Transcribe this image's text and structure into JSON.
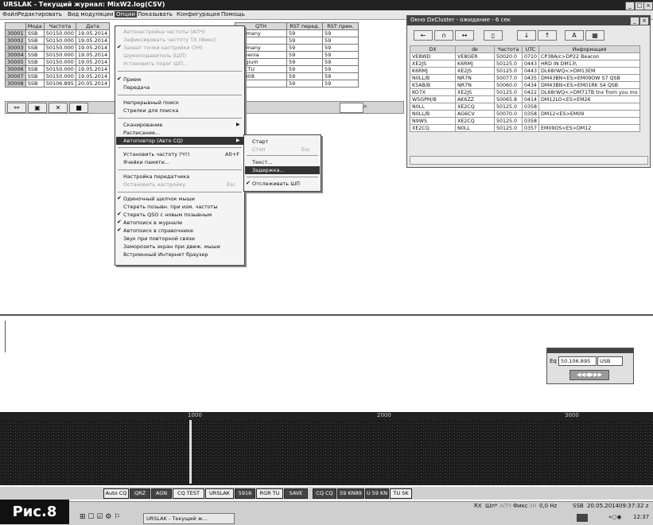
{
  "window_title": "URSLAK - Текущий журнал: MixW2.log(CSV)",
  "menubar": [
    "Файл",
    "Редактировать",
    "Вид модуляции",
    "Опции",
    "Показывать",
    "Конфигурация",
    "Помощь"
  ],
  "log": {
    "headers": [
      "",
      "Мода",
      "Частота",
      "Дата"
    ],
    "rows": [
      {
        "num": "30001",
        "mode": "SSB",
        "freq": "50150.000",
        "date": "19.05.2014"
      },
      {
        "num": "30002",
        "mode": "SSB",
        "freq": "50150.000",
        "date": "19.05.2014"
      },
      {
        "num": "30003",
        "mode": "SSB",
        "freq": "50150.000",
        "date": "19.05.2014"
      },
      {
        "num": "30004",
        "mode": "SSB",
        "freq": "50150.000",
        "date": "19.05.2014"
      },
      {
        "num": "30005",
        "mode": "SSB",
        "freq": "50150.000",
        "date": "19.05.2014"
      },
      {
        "num": "30006",
        "mode": "SSB",
        "freq": "50150.000",
        "date": "19.05.2014"
      },
      {
        "num": "30007",
        "mode": "SSB",
        "freq": "50150.000",
        "date": "19.05.2014"
      },
      {
        "num": "30008",
        "mode": "SSB",
        "freq": "50106.895",
        "date": "20.05.2014"
      }
    ],
    "headers2": [
      "QTH",
      "RST перед.",
      "RST прин."
    ],
    "rows2": [
      [
        "Germany",
        "59",
        "59"
      ],
      [
        "TUE",
        "59",
        "59"
      ],
      [
        "Germany",
        "59",
        "59"
      ],
      [
        "Slovenia",
        "59",
        "59"
      ],
      [
        "Belgium",
        "59",
        "59"
      ],
      [
        "D51TU",
        "59",
        "59"
      ],
      [
        "CD408",
        "59",
        "59"
      ],
      [
        "",
        "59",
        "59"
      ]
    ]
  },
  "options_menu": {
    "items": [
      {
        "label": "Автонастройка частоты (АПЧ)",
        "disabled": true
      },
      {
        "label": "Зафиксировать частоту TX (Фикс)",
        "disabled": true
      },
      {
        "label": "Захват точки настройки (ЗН)",
        "disabled": true,
        "check": true
      },
      {
        "label": "Шумоподавитель (ШП)",
        "disabled": true
      },
      {
        "label": "Установить порог ШП...",
        "disabled": true
      },
      {
        "label": "Прием",
        "check": true
      },
      {
        "label": "Передача"
      },
      {
        "label": "Непрерывный поиск"
      },
      {
        "label": "Стрелки для поиска"
      },
      {
        "label": "Сканирование",
        "arrow": true
      },
      {
        "label": "Расписание..."
      },
      {
        "label": "Автоповтор (Авто CQ)",
        "arrow": true,
        "highlight": true
      },
      {
        "label": "Установить частоту (Чт)",
        "shortcut": "Alt+F"
      },
      {
        "label": "Ячейки памяти..."
      },
      {
        "label": "Настройка передатчика"
      },
      {
        "label": "Остановить настройку",
        "disabled": true,
        "shortcut": "Esc"
      },
      {
        "label": "Одиночный щелчок мыши",
        "check": true
      },
      {
        "label": "Стереть позывн. при изм. частоты"
      },
      {
        "label": "Стереть QSO с новым позывным",
        "check": true
      },
      {
        "label": "Автопоиск в журнале",
        "check": true
      },
      {
        "label": "Автопоиск в справочнике",
        "check": true
      },
      {
        "label": "Звук при повторной связи"
      },
      {
        "label": "Заморозить экран при движ. мыши"
      },
      {
        "label": "Встроенный Интернет браузер"
      }
    ]
  },
  "submenu": {
    "items": [
      {
        "label": "Старт"
      },
      {
        "label": "Стоп",
        "disabled": true,
        "shortcut": "Esc"
      },
      {
        "label": "Текст..."
      },
      {
        "label": "Задержка...",
        "highlight": true
      },
      {
        "label": "Отслеживать ШП",
        "check": true
      }
    ]
  },
  "cluster": {
    "title": "Окно DxCluster - ожидание - 6 сек",
    "headers": [
      "DX",
      "de",
      "Частота",
      "UTC",
      "Информация"
    ],
    "rows": [
      [
        "VE8WD",
        "VE8GER",
        "50020.0",
        "0710",
        "CP38A/c>DP22 Beacon"
      ],
      [
        "XE2JS",
        "K6RMJ",
        "50125.0",
        "0443",
        "HRD IN DM13\\"
      ],
      [
        "K6RMJ",
        "XE2JS",
        "50125.0",
        "0443",
        "DL68rWQ<>DM13EM"
      ],
      [
        "N0LL/B",
        "NR7N",
        "50077.0",
        "0435",
        "DM43BN<ES>EM09OW S7 QSB"
      ],
      [
        "K5AB/B",
        "NR7N",
        "50060.0",
        "0434",
        "DM43BN<ES>EM01RK S4 QSB"
      ],
      [
        "KO7X",
        "XE2JS",
        "50125.0",
        "0422",
        "DL68rWQ<>DM71TB tnx from you mo"
      ],
      [
        "W5GPM/B",
        "AK6ZZ",
        "50065.8",
        "0414",
        "DM12LO<ES>EM26"
      ],
      [
        "N0LL",
        "XE2CQ",
        "50125.0",
        "0358",
        ""
      ],
      [
        "N0LL/B",
        "AG6CV",
        "50070.0",
        "0358",
        "DM12<ES>EM09"
      ],
      [
        "N9WS",
        "XE2CQ",
        "50125.0",
        "0358",
        ""
      ],
      [
        "XE2CQ",
        "N0LL",
        "50125.0",
        "0357",
        "EM09OS<ES>DM12"
      ]
    ]
  },
  "vfo": {
    "label": "Eq",
    "freq": "50.106.895",
    "mode": "USB"
  },
  "waterfall_ticks": [
    "1000",
    "2000",
    "3000"
  ],
  "macro_buttons": [
    "Auto CQ",
    "QRZ",
    "AGN",
    "CQ TEST",
    "URSLAK",
    "5916",
    "RGR TU",
    "SAVE",
    "CQ CQ",
    "59 KN89",
    "U 59 KN",
    "TU SK"
  ],
  "status": {
    "rx": "RX",
    "shp": "Шп*",
    "apch": "АПЧ",
    "fix": "Фикс",
    "zn": "ЗН",
    "hz": "0,0 Hz",
    "mode": "SSB",
    "datetime": "20.05.2014",
    "time": "09:37:32 z",
    "clock": "12:37"
  },
  "taskbar_item": "URSLAK - Текущий ж...",
  "figure_label": "Рис.8"
}
